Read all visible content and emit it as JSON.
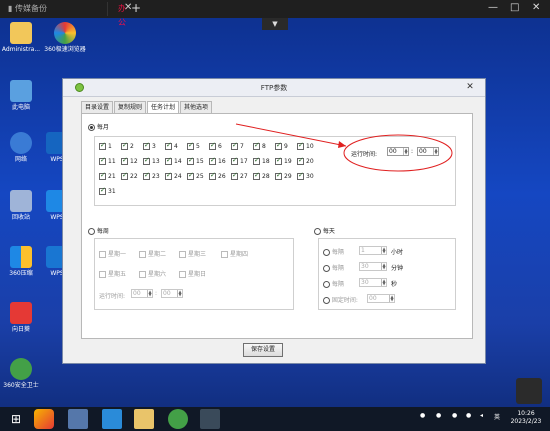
{
  "remote_bar": {
    "tab1_label": "传媒备份",
    "tab2_label": "办公",
    "dropdown": "▼"
  },
  "desktop_icons": [
    {
      "label": "Administra..."
    },
    {
      "label": "360极速浏览器"
    },
    {
      "label": "此电脑"
    },
    {
      "label": "网络"
    },
    {
      "label": "WPS"
    },
    {
      "label": "回收站"
    },
    {
      "label": "WPS"
    },
    {
      "label": "360压缩"
    },
    {
      "label": "WPS"
    },
    {
      "label": "向日葵"
    },
    {
      "label": "360安全卫士"
    }
  ],
  "window": {
    "title": "FTP参数",
    "close_glyph": "✕",
    "tabs": [
      "目录设置",
      "复制规则",
      "任务计划",
      "其他选项"
    ],
    "active_tab": 2,
    "daily_label": "每月",
    "days": [
      "1",
      "2",
      "3",
      "4",
      "5",
      "6",
      "7",
      "8",
      "9",
      "10",
      "11",
      "12",
      "13",
      "14",
      "15",
      "16",
      "17",
      "18",
      "19",
      "20",
      "21",
      "22",
      "23",
      "24",
      "25",
      "26",
      "27",
      "28",
      "29",
      "30",
      "31"
    ],
    "run_time_label": "运行时间:",
    "run_time_hour": "00",
    "run_time_min": "00",
    "weekly_label": "每周",
    "weekdays": [
      "星期一",
      "星期二",
      "星期三",
      "星期四",
      "星期五",
      "星期六",
      "星期日"
    ],
    "weekly_run_label": "运行时间:",
    "weekly_hour": "00",
    "weekly_min": "00",
    "everyday_label": "每天",
    "interval_rows": [
      {
        "label": "每隔",
        "value": "1",
        "unit": "小时"
      },
      {
        "label": "每隔",
        "value": "30",
        "unit": "分钟"
      },
      {
        "label": "每隔",
        "value": "30",
        "unit": "秒"
      },
      {
        "label": "固定时间:",
        "value": "00",
        "unit": ""
      }
    ],
    "save_button": "保存设置"
  },
  "taskbar": {
    "time": "10:26",
    "date": "2023/2/23",
    "ime": "英"
  },
  "colors": {
    "annotation": "#e02020",
    "desktop_top": "#0d2f8c"
  }
}
